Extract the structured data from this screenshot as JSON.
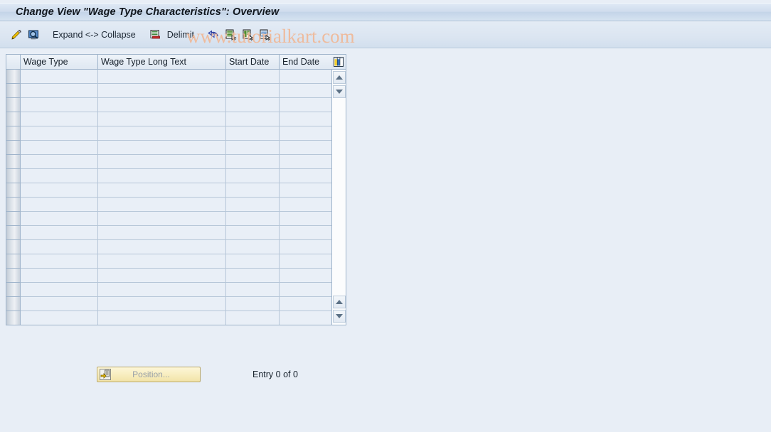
{
  "window": {
    "title": "Change View \"Wage Type Characteristics\": Overview"
  },
  "watermark": {
    "text": "www.tutorialkart.com",
    "color": "#f0b896"
  },
  "toolbar": {
    "items": [
      {
        "icon": "pencil-icon",
        "label": ""
      },
      {
        "icon": "display-magnifier-icon",
        "label": ""
      },
      {
        "icon": "",
        "label": "Expand <-> Collapse"
      },
      {
        "icon": "delimit-icon",
        "label": ""
      },
      {
        "icon": "",
        "label": "Delimit"
      },
      {
        "icon": "undo-delimitation-icon",
        "label": ""
      },
      {
        "icon": "copy-as-icon",
        "label": ""
      },
      {
        "icon": "paste-icon",
        "label": ""
      },
      {
        "icon": "detail-icon",
        "label": ""
      }
    ],
    "expand_collapse_label": "Expand <-> Collapse",
    "delimit_label": "Delimit"
  },
  "table": {
    "columns": [
      {
        "key": "wage_type",
        "label": "Wage Type"
      },
      {
        "key": "wage_type_long_text",
        "label": "Wage Type Long Text"
      },
      {
        "key": "start_date",
        "label": "Start Date"
      },
      {
        "key": "end_date",
        "label": "End Date"
      }
    ],
    "config_icon": "table-settings-icon",
    "rows": [],
    "empty_row_count": 18,
    "scrollbar": {
      "up_icon": "scroll-up-icon",
      "down_icon": "scroll-down-icon"
    }
  },
  "footer": {
    "position_button": {
      "icon": "position-icon",
      "label": "Position...",
      "enabled": false
    },
    "entry_count": "Entry 0 of 0"
  },
  "colors": {
    "page_background": "#e8eef6",
    "title_bar": "#cfdced",
    "grid_cell": "#e9eff7",
    "grid_line": "#b6c6d8",
    "border": "#9fb4cb"
  }
}
